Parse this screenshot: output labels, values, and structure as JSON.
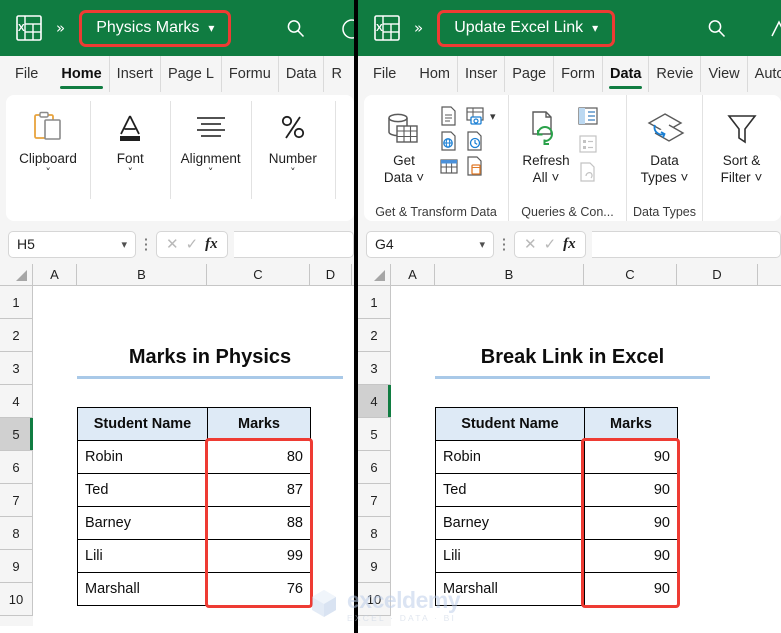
{
  "left": {
    "titlebar": {
      "logo_icon": "excel-logo-icon",
      "overflow_icon": "chevron-double-right-icon",
      "doc_name": "Physics Marks",
      "doc_caret_icon": "chevron-down-icon",
      "search_icon": "search-icon",
      "account_icon": "account-circle-icon"
    },
    "tabs": [
      {
        "label": "File",
        "active": false
      },
      {
        "label": "Home",
        "active": true
      },
      {
        "label": "Insert",
        "active": false
      },
      {
        "label": "Page L",
        "active": false
      },
      {
        "label": "Formu",
        "active": false
      },
      {
        "label": "Data",
        "active": false
      },
      {
        "label": "R",
        "active": false
      }
    ],
    "ribbon_groups": [
      {
        "label": "Clipboard",
        "icon": "clipboard-icon",
        "caret": "˅"
      },
      {
        "label": "Font",
        "icon": "font-a-icon",
        "caret": "˅"
      },
      {
        "label": "Alignment",
        "icon": "alignment-lines-icon",
        "caret": "˅"
      },
      {
        "label": "Number",
        "icon": "percent-icon",
        "caret": "˅"
      }
    ],
    "formula_bar": {
      "name_box": "H5",
      "name_caret_icon": "chevron-down-icon",
      "menu_icon": "vertical-dots-icon",
      "cancel_icon": "cancel-x-icon",
      "enter_icon": "enter-check-icon",
      "function_icon": "fx-icon",
      "formula_value": "",
      "formula_placeholder": ""
    },
    "grid": {
      "columns": [
        "A",
        "B",
        "C",
        "D"
      ],
      "rows": [
        "1",
        "2",
        "3",
        "4",
        "5",
        "6",
        "7",
        "8",
        "9",
        "10"
      ],
      "selected_row": "5",
      "sheet_title": "Marks in Physics",
      "table": {
        "headers": [
          "Student Name",
          "Marks"
        ],
        "rows": [
          [
            "Robin",
            "80"
          ],
          [
            "Ted",
            "87"
          ],
          [
            "Barney",
            "88"
          ],
          [
            "Lili",
            "99"
          ],
          [
            "Marshall",
            "76"
          ]
        ]
      }
    }
  },
  "right": {
    "titlebar": {
      "logo_icon": "excel-logo-icon",
      "overflow_icon": "chevron-double-right-icon",
      "doc_name": "Update Excel Link",
      "doc_caret_icon": "chevron-down-icon",
      "search_icon": "search-icon",
      "account_icon": "account-circle-icon"
    },
    "tabs": [
      {
        "label": "File",
        "active": false
      },
      {
        "label": "Hom",
        "active": false
      },
      {
        "label": "Inser",
        "active": false
      },
      {
        "label": "Page",
        "active": false
      },
      {
        "label": "Form",
        "active": false
      },
      {
        "label": "Data",
        "active": true
      },
      {
        "label": "Revie",
        "active": false
      },
      {
        "label": "View",
        "active": false
      },
      {
        "label": "Auto",
        "active": false
      }
    ],
    "ribbon_groups": [
      {
        "label": "Get & Transform Data",
        "main_button": "Get\nData",
        "main_line1": "Get",
        "main_line2": "Data",
        "main_caret": "˅",
        "main_icon": "get-data-database-icon",
        "mini_icons": [
          "from-text-csv-icon",
          "from-table-range-icon",
          "more-chevron-icon",
          "from-web-icon",
          "recent-sources-icon",
          "existing-connections-icon",
          "from-picture-icon"
        ]
      },
      {
        "label": "Queries & Con...",
        "main_line1": "Refresh",
        "main_line2": "All",
        "main_caret": "˅",
        "main_icon": "refresh-all-icon",
        "mini_icons": [
          "queries-connections-icon",
          "properties-icon",
          "edit-links-icon"
        ]
      },
      {
        "label": "Data Types",
        "main_line1": "Data",
        "main_line2": "Types",
        "main_caret": "˅",
        "main_icon": "data-types-stack-icon",
        "mini_icons": []
      },
      {
        "label": "",
        "main_line1": "Sort &",
        "main_line2": "Filter",
        "main_caret": "˅",
        "main_icon": "funnel-filter-icon",
        "mini_icons": []
      }
    ],
    "formula_bar": {
      "name_box": "G4",
      "name_caret_icon": "chevron-down-icon",
      "menu_icon": "vertical-dots-icon",
      "cancel_icon": "cancel-x-icon",
      "enter_icon": "enter-check-icon",
      "function_icon": "fx-icon",
      "formula_value": "",
      "formula_placeholder": ""
    },
    "grid": {
      "columns": [
        "A",
        "B",
        "C",
        "D"
      ],
      "rows": [
        "1",
        "2",
        "3",
        "4",
        "5",
        "6",
        "7",
        "8",
        "9",
        "10"
      ],
      "selected_row": "4",
      "sheet_title": "Break Link in Excel",
      "table": {
        "headers": [
          "Student Name",
          "Marks"
        ],
        "rows": [
          [
            "Robin",
            "90"
          ],
          [
            "Ted",
            "90"
          ],
          [
            "Barney",
            "90"
          ],
          [
            "Lili",
            "90"
          ],
          [
            "Marshall",
            "90"
          ]
        ]
      }
    }
  },
  "watermark": {
    "logo_icon": "exceldemy-cube-icon",
    "text": "exceldemy",
    "tagline": "EXCEL · DATA · BI"
  },
  "colors": {
    "excel_green": "#107c41",
    "highlight_red": "#ee3b33",
    "header_blue": "#deeaf6",
    "rule_blue": "#a9c9e8"
  }
}
